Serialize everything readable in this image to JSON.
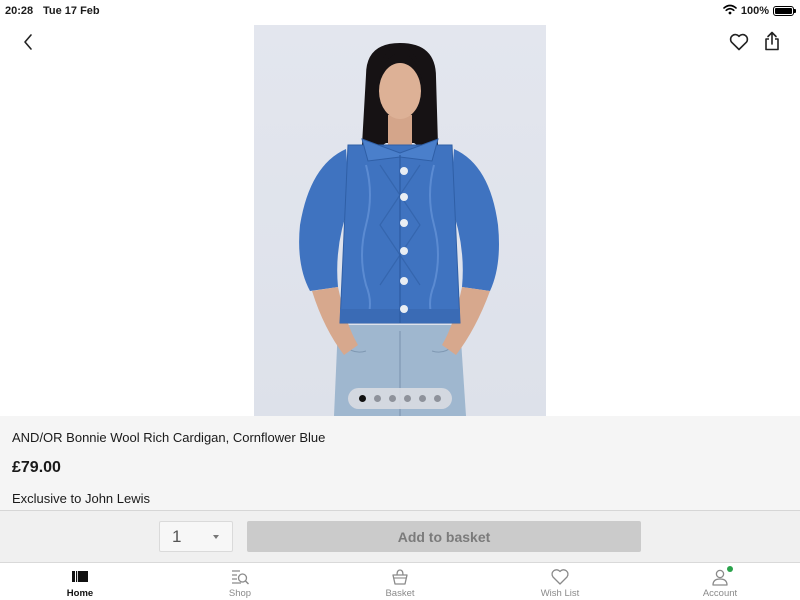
{
  "status_bar": {
    "time": "20:28",
    "date": "Tue 17 Feb",
    "battery_text": "100%",
    "battery_level": 1.0
  },
  "header": {
    "back_icon": "chevron-left-icon",
    "wishlist_icon": "heart-icon",
    "share_icon": "share-icon"
  },
  "gallery": {
    "image": "woman-wearing-blue-cardigan",
    "total_images": 6,
    "current_index": 1
  },
  "product": {
    "name": "AND/OR Bonnie Wool Rich Cardigan, Cornflower Blue",
    "price": "£79.00",
    "exclusive_text": "Exclusive to John Lewis"
  },
  "purchase": {
    "quantity": "1",
    "add_button_label": "Add to basket",
    "add_button_enabled": false
  },
  "tabs": [
    {
      "label": "Home",
      "icon": "home-icon",
      "active": true
    },
    {
      "label": "Shop",
      "icon": "shop-search-icon",
      "active": false
    },
    {
      "label": "Basket",
      "icon": "basket-icon",
      "active": false
    },
    {
      "label": "Wish List",
      "icon": "heart-icon",
      "active": false
    },
    {
      "label": "Account",
      "icon": "account-icon",
      "active": false,
      "has_notification": true
    }
  ],
  "colors": {
    "accent_notification": "#2aa24b",
    "cardigan": "#3f73c0",
    "disabled_button": "#cbcbcb"
  }
}
